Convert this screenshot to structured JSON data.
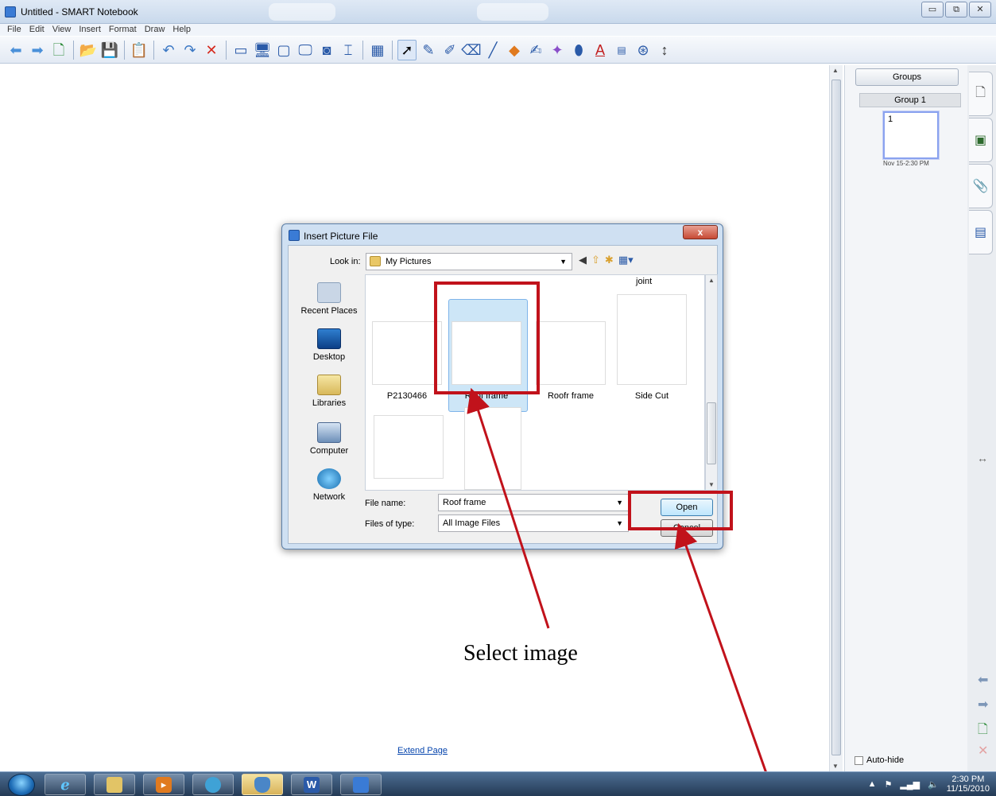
{
  "window": {
    "title": "Untitled - SMART Notebook",
    "buttons": {
      "minimize": "▭",
      "restore": "⧉",
      "close": "✕"
    }
  },
  "menu": [
    "File",
    "Edit",
    "View",
    "Insert",
    "Format",
    "Draw",
    "Help"
  ],
  "canvas": {
    "extend_page": "Extend Page"
  },
  "side_panel": {
    "groups_button": "Groups",
    "group_label": "Group 1",
    "page_number": "1",
    "page_caption": "Nov 15-2:30 PM",
    "autohide_label": "Auto-hide"
  },
  "dialog": {
    "title": "Insert Picture File",
    "close": "x",
    "look_in_label": "Look in:",
    "look_in_value": "My Pictures",
    "places": [
      "Recent Places",
      "Desktop",
      "Libraries",
      "Computer",
      "Network"
    ],
    "partial_top_label": "joint",
    "files": [
      "P2130466",
      "Roof frame",
      "Roofr frame",
      "Side Cut"
    ],
    "selected_file": "Roof frame",
    "file_name_label": "File name:",
    "file_name_value": "Roof frame",
    "files_of_type_label": "Files of type:",
    "files_of_type_value": "All Image Files",
    "open_button": "Open",
    "cancel_button": "Cancel"
  },
  "annotation": {
    "text": "Select image",
    "color": "#c1121b"
  },
  "taskbar": {
    "apps": [
      "internet-explorer",
      "file-explorer",
      "media-player",
      "messenger",
      "security",
      "word",
      "smart-notebook"
    ],
    "word_letter": "W",
    "clock_time": "2:30 PM",
    "clock_date": "11/15/2010"
  },
  "colors": {
    "highlight": "#c1121b",
    "selection": "#cde6f7"
  }
}
